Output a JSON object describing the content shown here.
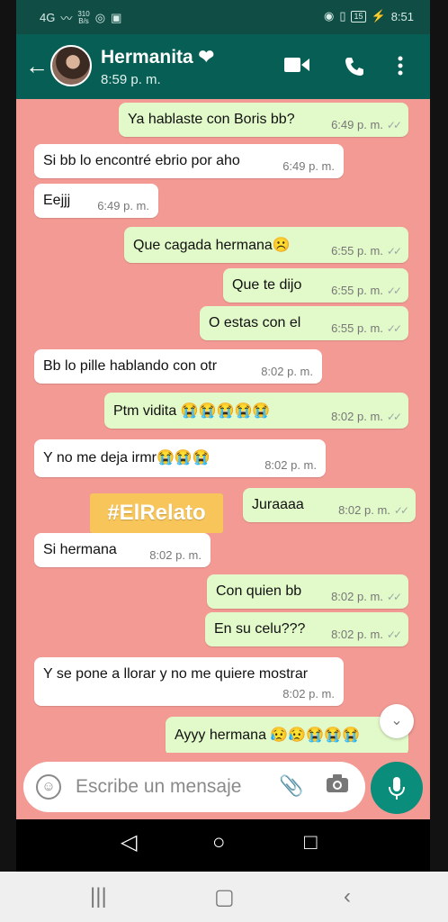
{
  "status_bar": {
    "network": "4G",
    "speed_value": "310",
    "speed_unit": "B/s",
    "battery": "15",
    "time": "8:51"
  },
  "header": {
    "back": "←",
    "name": "Hermanita ❤",
    "status": "8:59 p. m.",
    "video_icon": "video-icon",
    "call_icon": "phone-icon",
    "menu_icon": "more-vertical-icon"
  },
  "messages": [
    {
      "dir": "out",
      "text": "Ya hablaste con Boris bb?",
      "time": "6:49 p. m."
    },
    {
      "dir": "in",
      "text": "Si bb lo encontré ebrio por aho",
      "time": "6:49 p. m."
    },
    {
      "dir": "in",
      "text": "Eejjj",
      "time": "6:49 p. m."
    },
    {
      "dir": "out",
      "text": "Que cagada hermana☹️",
      "time": "6:55 p. m."
    },
    {
      "dir": "out",
      "text": "Que te dijo",
      "time": "6:55 p. m."
    },
    {
      "dir": "out",
      "text": "O estas con el",
      "time": "6:55 p. m."
    },
    {
      "dir": "in",
      "text": "Bb lo pille hablando con otr",
      "time": "8:02 p. m."
    },
    {
      "dir": "out",
      "text": "Ptm vidita 😭😭😭😭😭",
      "time": "8:02 p. m."
    },
    {
      "dir": "in",
      "text": "Y no me deja irmr😭😭😭",
      "time": "8:02 p. m."
    },
    {
      "dir": "out",
      "text": "Juraaaa",
      "time": "8:02 p. m."
    },
    {
      "dir": "in",
      "text": "Si hermana",
      "time": "8:02 p. m."
    },
    {
      "dir": "out",
      "text": "Con quien bb",
      "time": "8:02 p. m."
    },
    {
      "dir": "out",
      "text": "En su celu???",
      "time": "8:02 p. m."
    },
    {
      "dir": "in",
      "text": "Y se pone a llorar y no me quiere mostrar",
      "time": "8:02 p. m."
    },
    {
      "dir": "out",
      "text": "Ayyy hermana 😥😥😭😭😭",
      "time": ""
    }
  ],
  "watermark": "#ElRelato",
  "input": {
    "placeholder": "Escribe un mensaje"
  },
  "colors": {
    "header": "#075e54",
    "chat_bg": "#f29a93",
    "bubble_out": "#e2f9c9",
    "bubble_in": "#ffffff",
    "mic": "#0a8d7b"
  }
}
